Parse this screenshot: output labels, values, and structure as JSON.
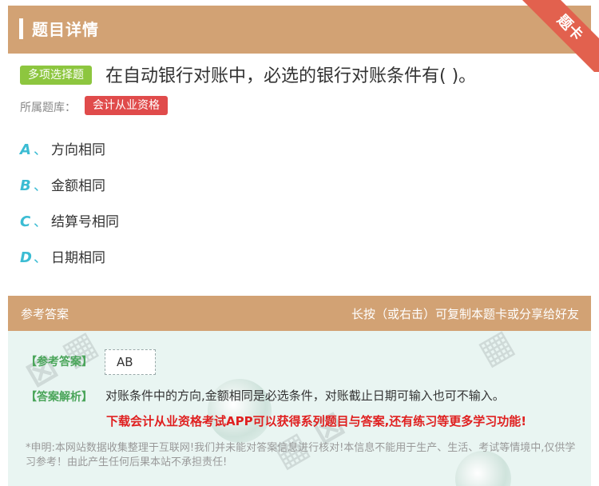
{
  "header": {
    "title": "题目详情",
    "ribbon": "题卡"
  },
  "question": {
    "type_tag": "多项选择题",
    "text": "在自动银行对账中，必选的银行对账条件有( )。",
    "bank_label": "所属题库：",
    "bank_name": "会计从业资格"
  },
  "options": [
    {
      "letter": "A",
      "sep": "、",
      "text": "方向相同"
    },
    {
      "letter": "B",
      "sep": "、",
      "text": "金额相同"
    },
    {
      "letter": "C",
      "sep": "、",
      "text": "结算号相同"
    },
    {
      "letter": "D",
      "sep": "、",
      "text": "日期相同"
    }
  ],
  "answer_section": {
    "title": "参考答案",
    "hint": "长按（或右击）可复制本题卡或分享给好友",
    "ref_label": "【参考答案】",
    "ref_value": "AB",
    "analysis_label": "【答案解析】",
    "analysis_text": "对账条件中的方向,金额相同是必选条件，对账截止日期可输入也可不输入。",
    "promo": "下载会计从业资格考试APP可以获得系列题目与答案,还有练习等更多学习功能!",
    "disclaimer": "*申明:本网站数据收集整理于互联网!我们并未能对答案信息进行核对!本信息不能用于生产、生活、考试等情境中,仅供学习参考！由此产生任何后果本站不承担责任!"
  },
  "colors": {
    "header": "#d2a274",
    "ribbon": "#e2614e",
    "tag_green": "#8dc63f",
    "tag_red": "#e04b4b",
    "option_letter": "#3bbcd3",
    "answer_bg": "#e9f5f2"
  }
}
